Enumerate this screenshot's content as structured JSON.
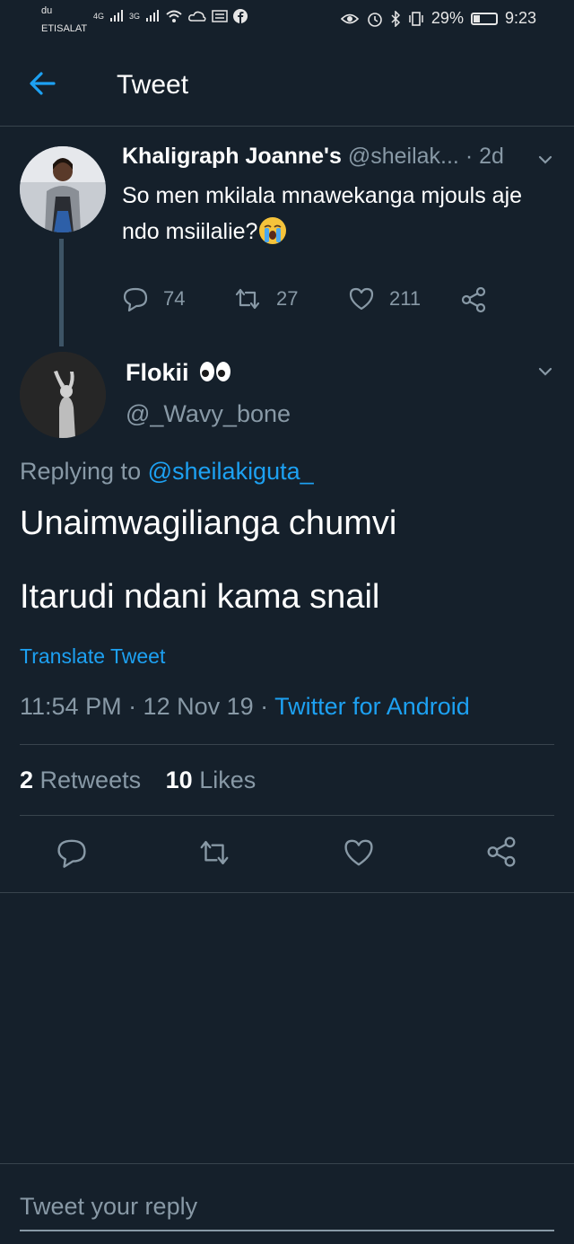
{
  "status_bar": {
    "carrier_top": "du",
    "carrier_bottom": "ETISALAT",
    "signal1": "4G",
    "signal2": "3G",
    "battery": "29%",
    "battery_level": 0.29,
    "time": "9:23"
  },
  "header": {
    "title": "Tweet"
  },
  "parent_tweet": {
    "name": "Khaligraph Joanne's",
    "handle": "@sheilak...",
    "age": "· 2d",
    "text": "So men mkilala mnawekanga mjouls aje ndo msiilalie?",
    "emoji": "loudly-crying-face",
    "replies": "74",
    "retweets": "27",
    "likes": "211"
  },
  "main_tweet": {
    "name": "Flokii",
    "name_emoji": "eyes",
    "handle": "@_Wavy_bone",
    "replying_label": "Replying to",
    "replying_handle": "@sheilakiguta_",
    "line1": "Unaimwagilianga chumvi",
    "line2": "Itarudi ndani kama snail",
    "translate": "Translate Tweet",
    "timestamp": "11:54 PM · 12 Nov 19 · ",
    "source": "Twitter for Android",
    "retweet_count": "2",
    "retweet_label": "Retweets",
    "like_count": "10",
    "like_label": "Likes"
  },
  "reply": {
    "placeholder": "Tweet your reply"
  },
  "colors": {
    "background": "#15202b",
    "accent": "#1da1f2",
    "muted": "#8899a6",
    "divider": "#38444d"
  }
}
